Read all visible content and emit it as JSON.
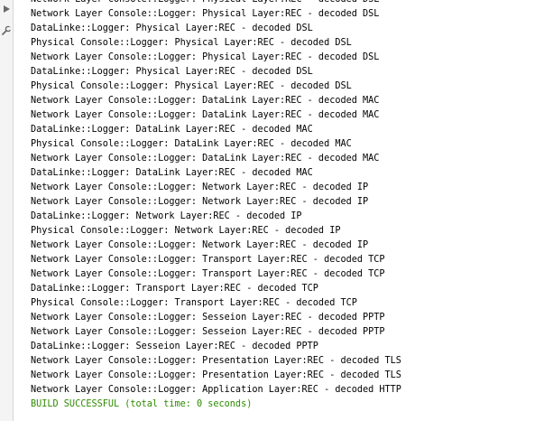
{
  "theme": {
    "output_color": "#000000",
    "success_color": "#2e8b00"
  },
  "gutter": {
    "icons": [
      "run-icon",
      "wrench-icon"
    ]
  },
  "console": {
    "lines": [
      "Network Layer Console::Logger: Physical Layer:REC - decoded DSL",
      "Network Layer Console::Logger: Physical Layer:REC - decoded DSL",
      "DataLinke::Logger: Physical Layer:REC - decoded DSL",
      "Physical Console::Logger: Physical Layer:REC - decoded DSL",
      "Network Layer Console::Logger: Physical Layer:REC - decoded DSL",
      "DataLinke::Logger: Physical Layer:REC - decoded DSL",
      "Physical Console::Logger: Physical Layer:REC - decoded DSL",
      "Network Layer Console::Logger: DataLink Layer:REC - decoded MAC",
      "Network Layer Console::Logger: DataLink Layer:REC - decoded MAC",
      "DataLinke::Logger: DataLink Layer:REC - decoded MAC",
      "Physical Console::Logger: DataLink Layer:REC - decoded MAC",
      "Network Layer Console::Logger: DataLink Layer:REC - decoded MAC",
      "DataLinke::Logger: DataLink Layer:REC - decoded MAC",
      "Network Layer Console::Logger: Network Layer:REC - decoded IP",
      "Network Layer Console::Logger: Network Layer:REC - decoded IP",
      "DataLinke::Logger: Network Layer:REC - decoded IP",
      "Physical Console::Logger: Network Layer:REC - decoded IP",
      "Network Layer Console::Logger: Network Layer:REC - decoded IP",
      "Network Layer Console::Logger: Transport Layer:REC - decoded TCP",
      "Network Layer Console::Logger: Transport Layer:REC - decoded TCP",
      "DataLinke::Logger: Transport Layer:REC - decoded TCP",
      "Physical Console::Logger: Transport Layer:REC - decoded TCP",
      "Network Layer Console::Logger: Sesseion Layer:REC - decoded PPTP",
      "Network Layer Console::Logger: Sesseion Layer:REC - decoded PPTP",
      "DataLinke::Logger: Sesseion Layer:REC - decoded PPTP",
      "Network Layer Console::Logger: Presentation Layer:REC - decoded TLS",
      "Network Layer Console::Logger: Presentation Layer:REC - decoded TLS",
      "Network Layer Console::Logger: Application Layer:REC - decoded HTTP"
    ],
    "build_status": "BUILD SUCCESSFUL (total time: 0 seconds)"
  }
}
